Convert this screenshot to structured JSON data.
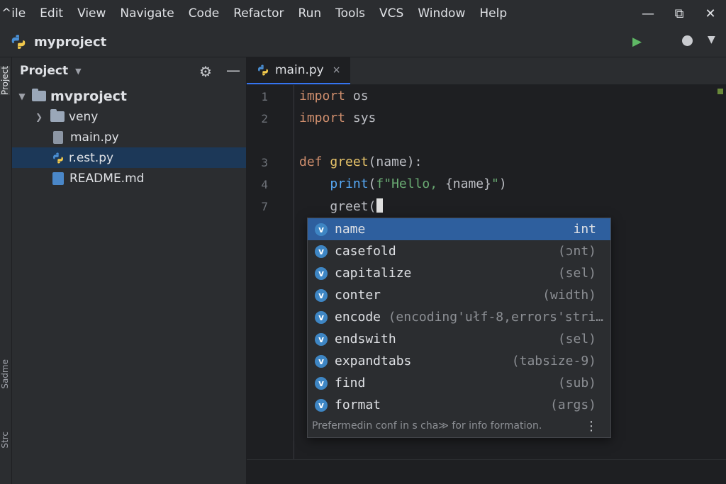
{
  "menu": [
    "ile",
    "Edit",
    "View",
    "Navigate",
    "Code",
    "Refactor",
    "Run",
    "Tools",
    "VCS",
    "Window",
    "Help"
  ],
  "menu_first_prefix": "^",
  "window_controls": {
    "minimize": "—",
    "restore": "⧉",
    "close": "✕"
  },
  "toolbar": {
    "project_name": "myproject",
    "run_icon": "run-icon",
    "record_icon": "record-icon",
    "more_icon": "chevron-down-icon"
  },
  "left_strip": {
    "tabs": [
      "Project",
      "Sadme",
      "Strc"
    ]
  },
  "project_panel": {
    "title": "Project",
    "tree": [
      {
        "label": "mvproject",
        "type": "folder",
        "expanded": true,
        "level": 0
      },
      {
        "label": "veny",
        "type": "folder",
        "expanded": false,
        "level": 1
      },
      {
        "label": "main.py",
        "type": "file",
        "level": 1
      },
      {
        "label": "r.est.py",
        "type": "python",
        "level": 1,
        "selected": true
      },
      {
        "label": "README.md",
        "type": "markdown",
        "level": 1
      }
    ]
  },
  "editor": {
    "tab_label": "main.py",
    "tab_close": "×",
    "line_numbers": [
      "1",
      "2",
      "3",
      "4",
      "7"
    ],
    "code": {
      "l1_kw": "import",
      "l1_rest": " os",
      "l2_kw": "import",
      "l2_rest": " sys",
      "l3_kw": "def",
      "l3_fn": " greet",
      "l3_rest": "(name):",
      "l4_indent": "    ",
      "l4_fn": "print",
      "l4_open": "(",
      "l4_str": "f\"Hello, ",
      "l4_interp": "{name}",
      "l4_str_end": "\"",
      "l4_close": ")",
      "l7_indent": "    ",
      "l7_text": "greet("
    }
  },
  "completion": {
    "items": [
      {
        "name": "name",
        "type": "int",
        "selected": true
      },
      {
        "name": "casefold",
        "type": "(ɔnt)"
      },
      {
        "name": "capitalize",
        "type": "(sel)"
      },
      {
        "name": "conter",
        "type": "(width)"
      },
      {
        "name": "encode",
        "type": "(encoding'ułf-8,errors'stri…"
      },
      {
        "name": "endswith",
        "type": "(sel)"
      },
      {
        "name": "expandtabs",
        "type": "(tabsize-9)"
      },
      {
        "name": "find",
        "type": "(sub)"
      },
      {
        "name": "format",
        "type": "(args)"
      }
    ],
    "badge": "v",
    "footer_hint": "Prefermedin conf in s cha≫ for info formation.",
    "footer_menu": "⋮"
  },
  "colors": {
    "accent": "#3574f0",
    "selection": "#2e5f9e",
    "keyword": "#cf8e6d",
    "function": "#56a8f5",
    "string": "#6aab73",
    "run_green": "#5fb865"
  }
}
